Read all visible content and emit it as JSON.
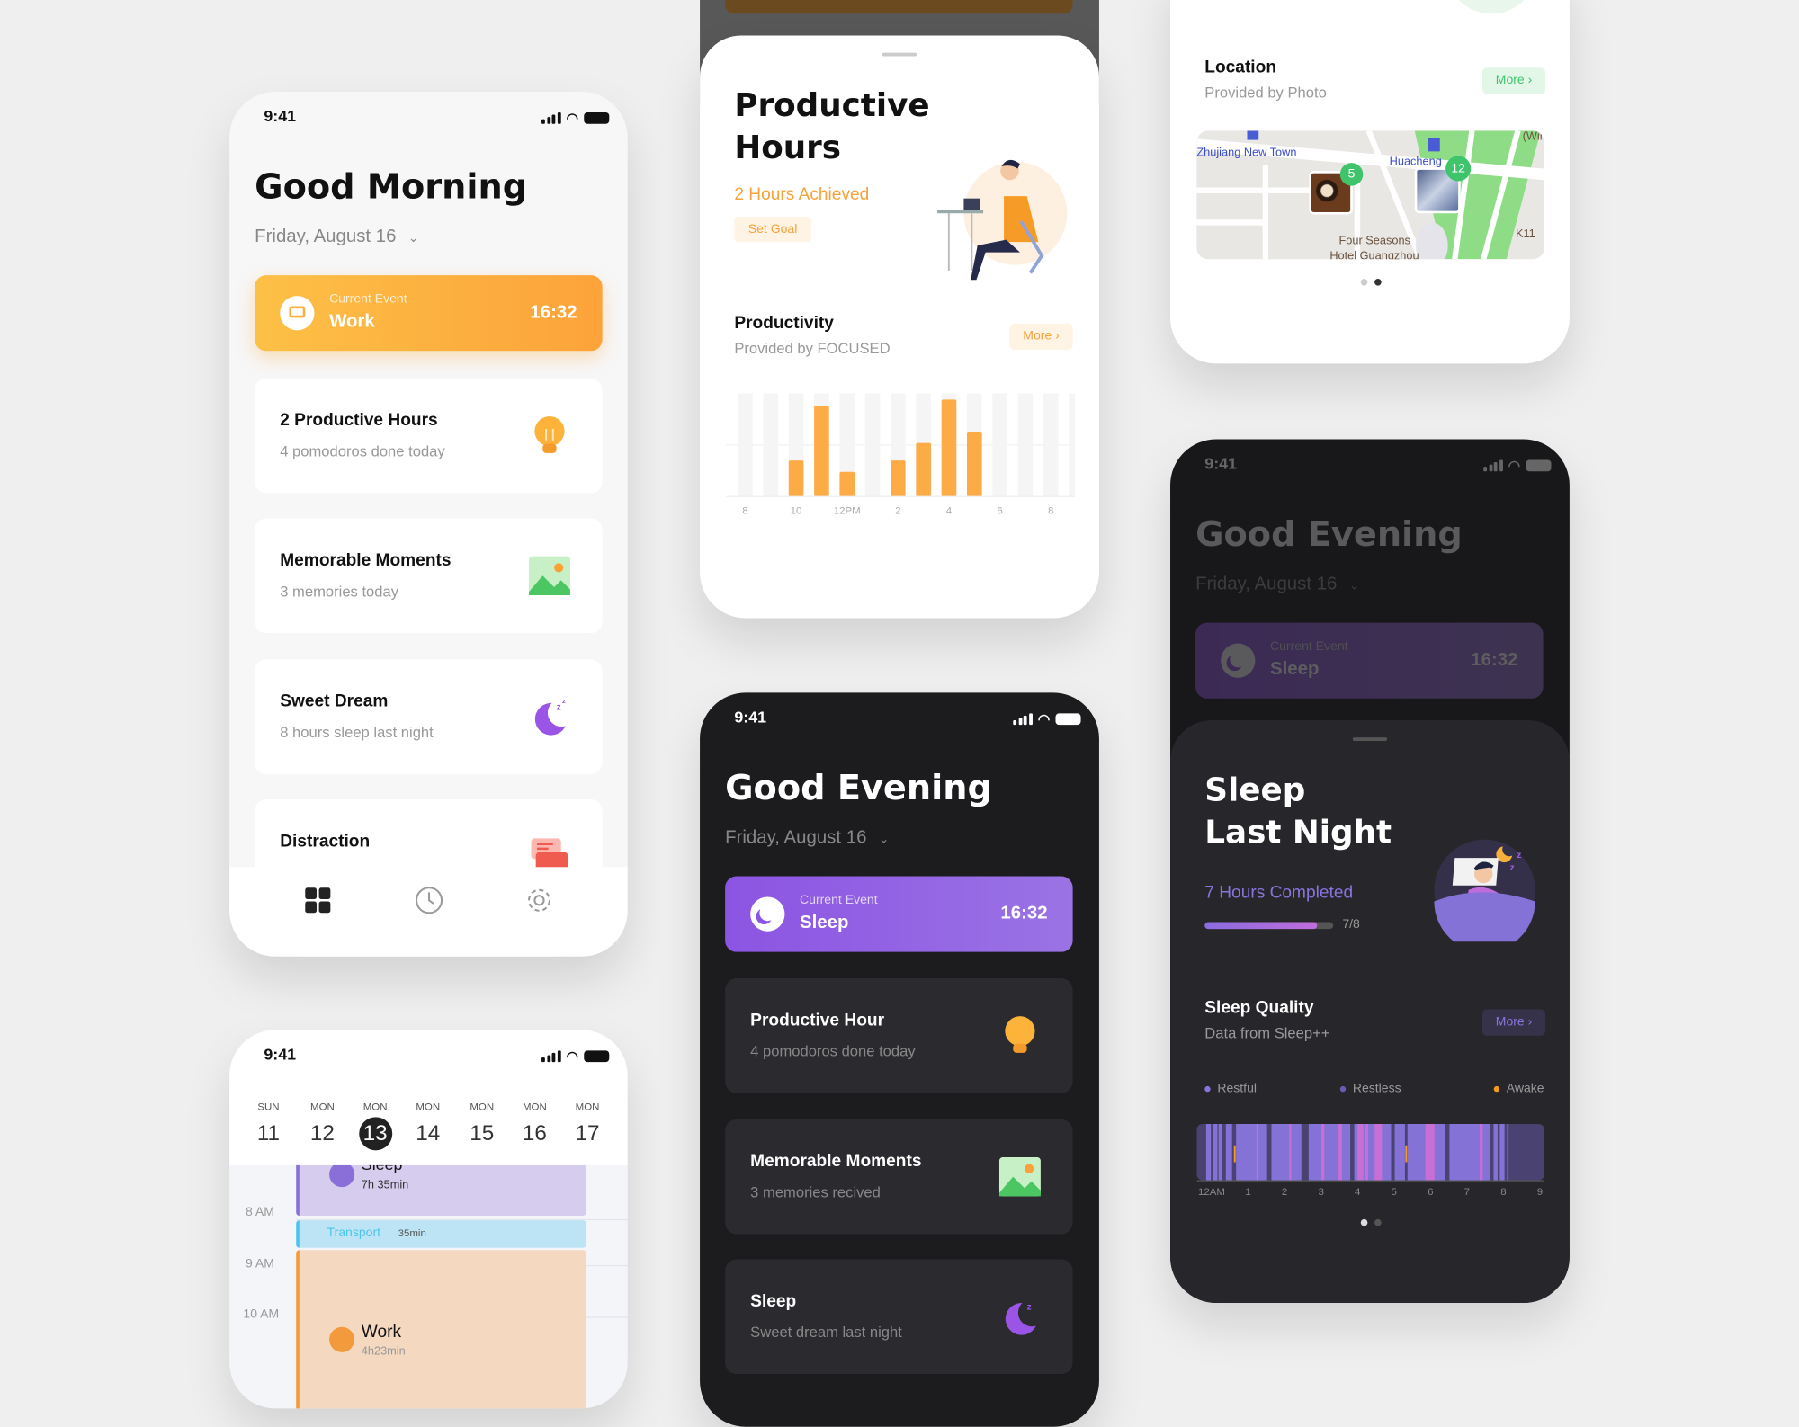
{
  "morning": {
    "status_time": "9:41",
    "title": "Good Morning",
    "date": "Friday, August 16",
    "current_event": {
      "label": "Current Event",
      "name": "Work",
      "time": "16:32",
      "icon": "monitor-icon"
    },
    "cards": [
      {
        "title": "2 Productive Hours",
        "subtitle": "4 pomodoros done today",
        "icon": "lightbulb-icon"
      },
      {
        "title": "Memorable Moments",
        "subtitle": "3 memories today",
        "icon": "image-icon"
      },
      {
        "title": "Sweet Dream",
        "subtitle": "8 hours sleep last night",
        "icon": "moon-icon"
      },
      {
        "title": "Distraction",
        "icon": "chat-icon"
      }
    ],
    "tabs": [
      "grid-icon",
      "clock-icon",
      "gear-icon"
    ]
  },
  "productive": {
    "title_line1": "Productive",
    "title_line2": "Hours",
    "achieved": "2 Hours Achieved",
    "set_goal": "Set Goal",
    "section_title": "Productivity",
    "section_subtitle": "Provided by FOCUSED",
    "more": "More ›"
  },
  "location": {
    "title": "Location",
    "subtitle": "Provided by Photo",
    "more": "More ›",
    "map_labels": {
      "a": "Zhujiang New Town",
      "b": "Huacheng",
      "c": "Four Seasons",
      "d": "Hotel Guangzhou",
      "e": "K11",
      "f": "(Wir"
    },
    "markers": [
      "5",
      "12"
    ],
    "page": 2,
    "pages": 2
  },
  "evening": {
    "status_time": "9:41",
    "title": "Good Evening",
    "date": "Friday, August 16",
    "current_event": {
      "label": "Current Event",
      "name": "Sleep",
      "time": "16:32",
      "icon": "moon-icon"
    },
    "cards": [
      {
        "title": "Productive Hour",
        "subtitle": "4 pomodoros done today",
        "icon": "lightbulb-icon"
      },
      {
        "title": "Memorable Moments",
        "subtitle": "3 memories recived",
        "icon": "image-icon"
      },
      {
        "title": "Sleep",
        "subtitle": "Sweet dream last night",
        "icon": "moon-icon"
      }
    ]
  },
  "sleep": {
    "status_time": "9:41",
    "title": "Good Evening",
    "date": "Friday, August 16",
    "current_event": {
      "label": "Current Event",
      "name": "Sleep",
      "time": "16:32"
    },
    "sheet_title_line1": "Sleep",
    "sheet_title_line2": "Last Night",
    "completed": "7 Hours Completed",
    "progress_text": "7/8",
    "progress": 0.875,
    "quality_title": "Sleep Quality",
    "quality_subtitle": "Data from Sleep++",
    "more": "More ›",
    "legend": [
      {
        "label": "Restful",
        "color": "#8a74dc"
      },
      {
        "label": "Restless",
        "color": "#6b5bb4"
      },
      {
        "label": "Awake",
        "color": "#f59a1b"
      }
    ],
    "page": 1,
    "pages": 2
  },
  "calendar": {
    "status_time": "9:41",
    "days": [
      {
        "dow": "SUN",
        "num": "11"
      },
      {
        "dow": "MON",
        "num": "12"
      },
      {
        "dow": "MON",
        "num": "13",
        "selected": true
      },
      {
        "dow": "MON",
        "num": "14"
      },
      {
        "dow": "MON",
        "num": "15"
      },
      {
        "dow": "MON",
        "num": "16"
      },
      {
        "dow": "MON",
        "num": "17"
      }
    ],
    "times": [
      "8 AM",
      "9 AM",
      "10 AM"
    ],
    "events": {
      "sleep": {
        "name": "Sleep",
        "duration": "7h 35min"
      },
      "transport": {
        "name": "Transport",
        "duration": "35min"
      },
      "work": {
        "name": "Work",
        "duration": "4h23min"
      }
    }
  },
  "colors": {
    "orange": "#fdae3a",
    "purple": "#8b5be0",
    "green": "#3fc46b",
    "dark_bg": "#1c1c1f"
  },
  "chart_data": [
    {
      "type": "bar",
      "title": "Productivity",
      "x": [
        8,
        9,
        10,
        11,
        12,
        13,
        14,
        15,
        16,
        17,
        18,
        19,
        20,
        21
      ],
      "x_tick_labels": [
        "8",
        "10",
        "12PM",
        "2",
        "4",
        "6",
        "8"
      ],
      "values": [
        0,
        0,
        35,
        88,
        24,
        0,
        35,
        52,
        94,
        63,
        0,
        0,
        0,
        0
      ],
      "ylim": [
        0,
        100
      ],
      "grid": true
    },
    {
      "type": "timeline",
      "title": "Sleep Quality",
      "x_tick_labels": [
        "12AM",
        "1",
        "2",
        "3",
        "4",
        "5",
        "6",
        "7",
        "8",
        "9"
      ],
      "xlim": [
        -0.41,
        9.12
      ],
      "background_color": "#4a4270",
      "segments": [
        {
          "start": -0.15,
          "end": -0.02,
          "color": "#8572d6"
        },
        {
          "start": 0.04,
          "end": 0.16,
          "color": "#8572d6"
        },
        {
          "start": 0.19,
          "end": 0.29,
          "color": "#8572d6"
        },
        {
          "start": 0.39,
          "end": 0.56,
          "color": "#8572d6"
        },
        {
          "start": 0.67,
          "end": 1.52,
          "color": "#8572d6"
        },
        {
          "start": 1.64,
          "end": 2.46,
          "color": "#8572d6"
        },
        {
          "start": 2.66,
          "end": 3.8,
          "color": "#8572d6"
        },
        {
          "start": 3.91,
          "end": 4.92,
          "color": "#8572d6"
        },
        {
          "start": 5.02,
          "end": 5.3,
          "color": "#8572d6"
        },
        {
          "start": 5.37,
          "end": 6.39,
          "color": "#8572d6"
        },
        {
          "start": 6.52,
          "end": 7.62,
          "color": "#8572d6"
        },
        {
          "start": 7.73,
          "end": 7.84,
          "color": "#8572d6"
        },
        {
          "start": 7.9,
          "end": 8.03,
          "color": "#8572d6"
        },
        {
          "start": 8.1,
          "end": 8.14,
          "color": "#8572d6"
        },
        {
          "start": 1.23,
          "end": 1.28,
          "color": "#c86fd6"
        },
        {
          "start": 2.13,
          "end": 2.18,
          "color": "#c86fd6"
        },
        {
          "start": 3.01,
          "end": 3.09,
          "color": "#c86fd6"
        },
        {
          "start": 3.48,
          "end": 3.57,
          "color": "#c86fd6"
        },
        {
          "start": 4.0,
          "end": 4.16,
          "color": "#c86fd6"
        },
        {
          "start": 4.2,
          "end": 4.29,
          "color": "#c86fd6"
        },
        {
          "start": 4.47,
          "end": 4.67,
          "color": "#c86fd6"
        },
        {
          "start": 5.86,
          "end": 6.11,
          "color": "#c86fd6"
        },
        {
          "start": 7.35,
          "end": 7.43,
          "color": "#c86fd6"
        },
        {
          "start": 0.61,
          "end": 0.66,
          "color": "#f59a1b",
          "awake": true
        },
        {
          "start": 5.31,
          "end": 5.36,
          "color": "#f59a1b",
          "awake": true
        }
      ]
    }
  ]
}
